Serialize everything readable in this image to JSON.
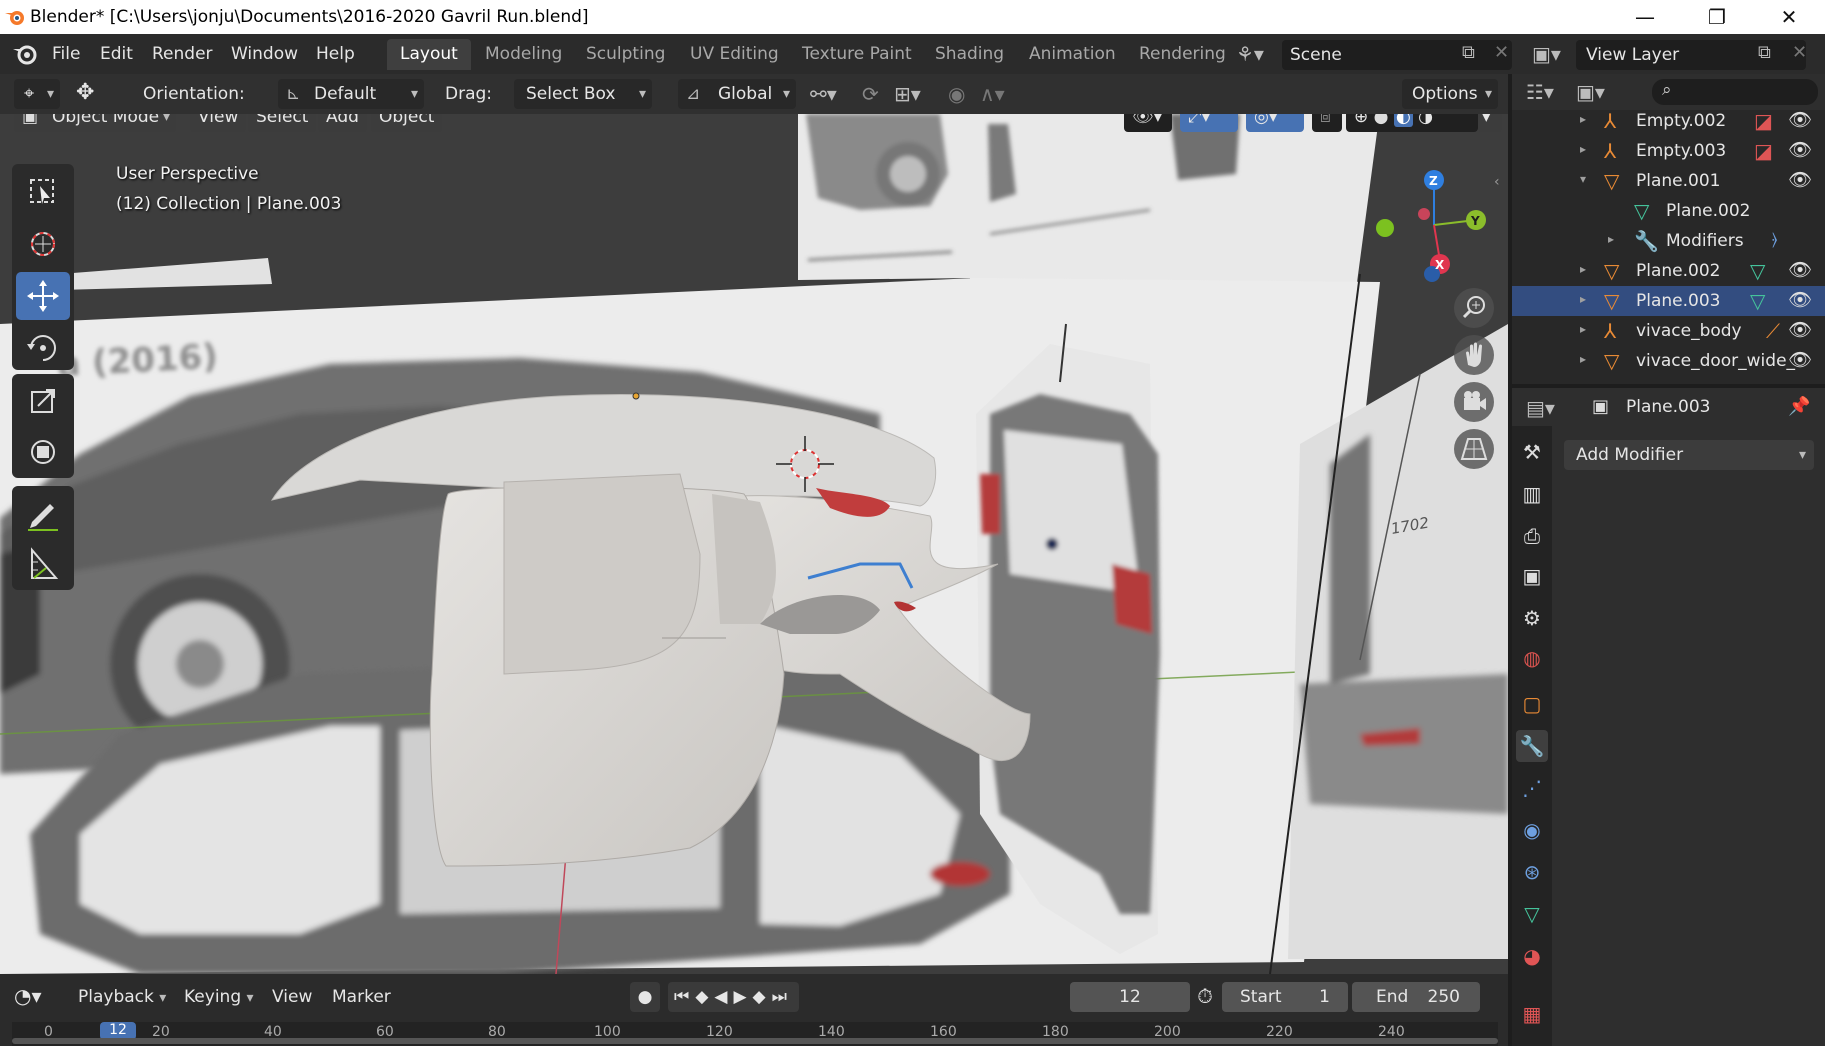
{
  "window": {
    "title": "Blender* [C:\\Users\\jonju\\Documents\\2016-2020 Gavril Run.blend]",
    "minimize": "—",
    "maximize": "❐",
    "close": "✕"
  },
  "menu": {
    "items": [
      "File",
      "Edit",
      "Render",
      "Window",
      "Help"
    ]
  },
  "workspaces": {
    "tabs": [
      "Layout",
      "Modeling",
      "Sculpting",
      "UV Editing",
      "Texture Paint",
      "Shading",
      "Animation",
      "Rendering"
    ],
    "active": "Layout"
  },
  "scene": {
    "name": "Scene"
  },
  "view_layer": {
    "name": "View Layer"
  },
  "viewport_header": {
    "orientation_label": "Orientation:",
    "orientation_value": "Default",
    "drag_label": "Drag:",
    "drag_value": "Select Box",
    "transform_orientation": "Global",
    "options_label": "Options"
  },
  "viewport_menu": {
    "mode": "Object Mode",
    "items": [
      "View",
      "Select",
      "Add",
      "Object"
    ]
  },
  "viewport_overlay_text": {
    "perspective": "User Perspective",
    "collection": "(12) Collection | Plane.003"
  },
  "gizmo": {
    "z": "Z",
    "y": "Y",
    "x": "X"
  },
  "reference_images": {
    "title_fragment": "a (2016)",
    "dimension_label": "1702"
  },
  "timeline": {
    "menu": [
      "Playback",
      "Keying",
      "View",
      "Marker"
    ],
    "current_frame": "12",
    "start_label": "Start",
    "start_value": "1",
    "end_label": "End",
    "end_value": "250",
    "ruler": [
      "0",
      "12",
      "20",
      "40",
      "60",
      "80",
      "100",
      "120",
      "140",
      "160",
      "180",
      "200",
      "220",
      "240"
    ]
  },
  "outliner": {
    "rows": [
      {
        "label": "Empty.002",
        "type": "empty"
      },
      {
        "label": "Empty.003",
        "type": "empty"
      },
      {
        "label": "Plane.001",
        "type": "mesh"
      },
      {
        "label": "Plane.002",
        "type": "mesh-data"
      },
      {
        "label": "Modifiers",
        "type": "modifier"
      },
      {
        "label": "Plane.002",
        "type": "mesh"
      },
      {
        "label": "Plane.003",
        "type": "mesh"
      },
      {
        "label": "vivace_body",
        "type": "armature"
      },
      {
        "label": "vivace_door_wide_",
        "type": "mesh"
      }
    ]
  },
  "properties": {
    "object_name": "Plane.003",
    "add_modifier_label": "Add Modifier"
  },
  "colors": {
    "accent_blue": "#4772b3",
    "axis_x": "#e0364f",
    "axis_y": "#8bbd2b",
    "axis_z": "#2f7fe0",
    "orange_object": "#e88a35"
  }
}
